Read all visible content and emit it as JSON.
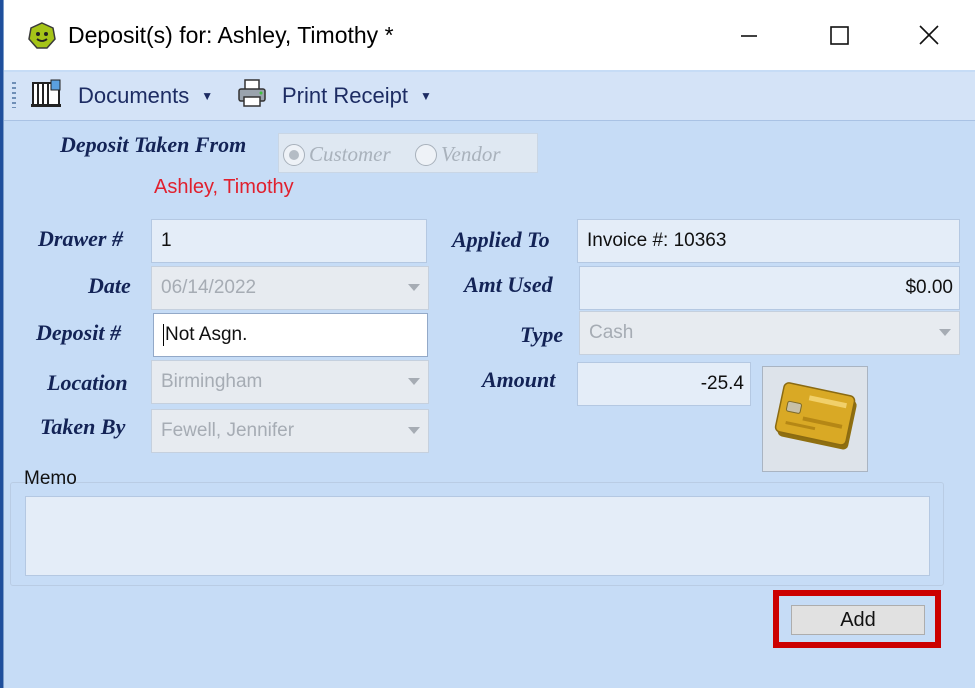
{
  "window": {
    "title": "Deposit(s) for: Ashley, Timothy *",
    "icon": "smiley-app-icon",
    "controls": [
      "minimize-icon",
      "maximize-icon",
      "close-icon"
    ]
  },
  "toolbar": {
    "documents_label": "Documents",
    "print_receipt_label": "Print Receipt"
  },
  "deposit_from": {
    "label": "Deposit Taken From",
    "options": [
      {
        "label": "Customer",
        "selected": true
      },
      {
        "label": "Vendor",
        "selected": false
      }
    ],
    "customer_name": "Ashley, Timothy"
  },
  "form": {
    "drawer_label": "Drawer #",
    "drawer_value": "1",
    "date_label": "Date",
    "date_value": "06/14/2022",
    "deposit_label": "Deposit #",
    "deposit_value": "Not Asgn.",
    "location_label": "Location",
    "location_value": "Birmingham",
    "taken_by_label": "Taken By",
    "taken_by_value": "Fewell, Jennifer",
    "applied_to_label": "Applied To",
    "applied_to_value": "Invoice #: 10363",
    "amt_used_label": "Amt Used",
    "amt_used_value": "$0.00",
    "type_label": "Type",
    "type_value": "Cash",
    "amount_label": "Amount",
    "amount_value": "-25.4",
    "card_icon": "credit-card-icon"
  },
  "memo": {
    "label": "Memo",
    "value": ""
  },
  "actions": {
    "add_label": "Add",
    "highlight_color": "#cc0000"
  },
  "colors": {
    "background": "#c6dcf6",
    "label_text": "#132356",
    "customer_name": "#e0202e"
  }
}
